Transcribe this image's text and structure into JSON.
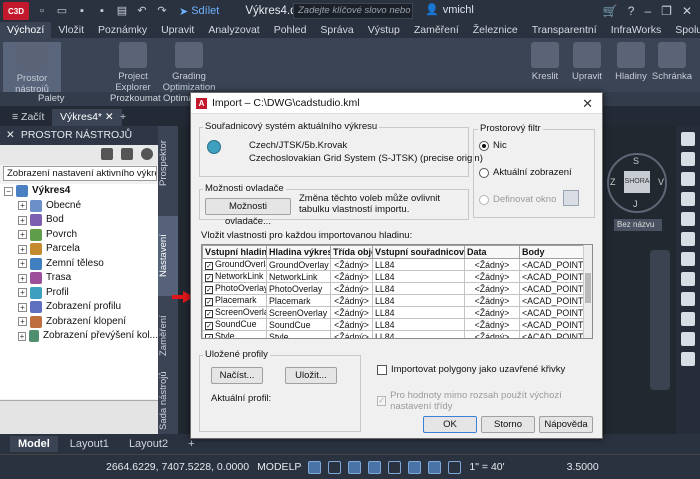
{
  "titlebar": {
    "logo": "C3D",
    "share": "Sdílet",
    "title": "Výkres4.d...",
    "search_placeholder": "Zadejte klíčové slovo nebo výraz.",
    "user": "vmichl"
  },
  "menu_tabs": [
    "Výchozí",
    "Vložit",
    "Poznámky",
    "Upravit",
    "Analyzovat",
    "Pohled",
    "Správa",
    "Výstup",
    "Zaměření",
    "Železnice",
    "Transparentní",
    "InfraWorks",
    "Spolupráce"
  ],
  "ribbon": {
    "buttons": [
      "Prostor nástrojů",
      "Project Explorer",
      "Grading Optimization",
      "Kreslit",
      "Upravit",
      "Hladiny",
      "Schránka"
    ],
    "labels": [
      "Palety",
      "Prozkoumat",
      "Optimaliza"
    ]
  },
  "doc_tabs": {
    "start": "Začít",
    "drawing": "Výkres4*"
  },
  "palette": {
    "title": "PROSTOR NÁSTROJŮ",
    "select_value": "Zobrazení nastavení aktivního výkresu",
    "tree": [
      {
        "label": "Výkres4",
        "root": true,
        "color": "#4a7fc1"
      },
      {
        "label": "Obecné",
        "color": "#6b8fc9"
      },
      {
        "label": "Bod",
        "color": "#7c5fb0"
      },
      {
        "label": "Povrch",
        "color": "#5f9d4a"
      },
      {
        "label": "Parcela",
        "color": "#c48a2f"
      },
      {
        "label": "Zemní těleso",
        "color": "#3f7fbf"
      },
      {
        "label": "Trasa",
        "color": "#9b4f9b"
      },
      {
        "label": "Profil",
        "color": "#3f9fbf"
      },
      {
        "label": "Zobrazení profilu",
        "color": "#5f6fbf"
      },
      {
        "label": "Zobrazení klopení",
        "color": "#bf6f3f"
      },
      {
        "label": "Zobrazení převýšení kol...",
        "color": "#4f8f6f"
      }
    ],
    "vertical_tabs": [
      "Prospektor",
      "Nastavení",
      "Zaměření",
      "Sada nástrojů"
    ]
  },
  "viewcube": {
    "face": "SHORA",
    "north": "S",
    "south": "J",
    "west": "Z",
    "east": "V",
    "wcs": "Bez názvu"
  },
  "layout_tabs": [
    "Model",
    "Layout1",
    "Layout2"
  ],
  "statusbar": {
    "coords": "2664.6229, 7407.5228, 0.0000",
    "mode": "MODELP",
    "scale": "1\" = 40'",
    "annotation": "3.5000"
  },
  "dialog": {
    "title": "Import – C:\\DWG\\cadstudio.kml",
    "cs_group": "Souřadnicový systém aktuálního výkresu",
    "cs_line1": "Czech/JTSK/5b.Krovak",
    "cs_line2": "Czechoslovakian Grid System (S-JTSK) (precise origin)",
    "filter_group": "Prostorový filtr",
    "filter_none": "Nic",
    "filter_current": "Aktuální zobrazení",
    "filter_window": "Definovat okno",
    "driver_group": "Možnosti ovladače",
    "driver_button": "Možnosti ovladače...",
    "driver_note": "Změna těchto voleb může ovlivnit tabulku vlastností importu.",
    "table_label": "Vložit vlastnosti pro každou importovanou hladinu:",
    "columns": [
      "Vstupní hladina",
      "Hladina výkresu",
      "Třída obje",
      "Vstupní souřadnicový",
      "Data",
      "Body"
    ],
    "rows": [
      {
        "input": "GroundOverla",
        "layer": "GroundOverlay",
        "class": "<Žádný>",
        "cs": "LL84",
        "data": "<Žádný>",
        "points": "<ACAD_POINT>"
      },
      {
        "input": "NetworkLink",
        "layer": "NetworkLink",
        "class": "<Žádný>",
        "cs": "LL84",
        "data": "<Žádný>",
        "points": "<ACAD_POINT>"
      },
      {
        "input": "PhotoOverlay",
        "layer": "PhotoOverlay",
        "class": "<Žádný>",
        "cs": "LL84",
        "data": "<Žádný>",
        "points": "<ACAD_POINT>"
      },
      {
        "input": "Placemark",
        "layer": "Placemark",
        "class": "<Žádný>",
        "cs": "LL84",
        "data": "<Žádný>",
        "points": "<ACAD_POINT>"
      },
      {
        "input": "ScreenOverla",
        "layer": "ScreenOverlay",
        "class": "<Žádný>",
        "cs": "LL84",
        "data": "<Žádný>",
        "points": "<ACAD_POINT>"
      },
      {
        "input": "SoundCue",
        "layer": "SoundCue",
        "class": "<Žádný>",
        "cs": "LL84",
        "data": "<Žádný>",
        "points": "<ACAD_POINT>"
      },
      {
        "input": "Style",
        "layer": "Style",
        "class": "<Žádný>",
        "cs": "LL84",
        "data": "<Žádný>",
        "points": "<ACAD_POINT>"
      }
    ],
    "profiles_group": "Uložené profily",
    "load_button": "Načíst...",
    "save_button": "Uložit...",
    "current_profile": "Aktuální profil:",
    "polygons_check": "Importovat polygony jako uzavřené křivky",
    "default_class_check": "Pro hodnoty mimo rozsah použít výchozí nastavení třídy",
    "ok": "OK",
    "cancel": "Storno",
    "help": "Nápověda"
  }
}
